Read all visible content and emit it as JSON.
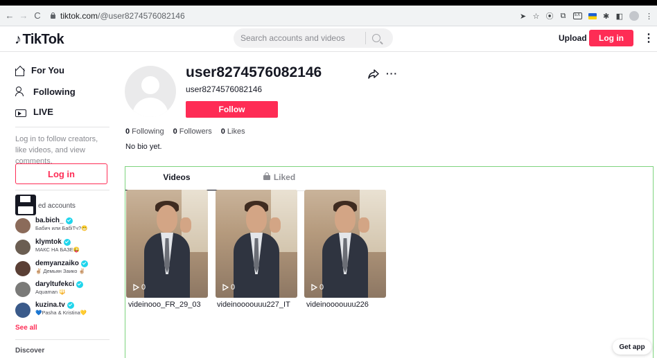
{
  "browser": {
    "url_domain": "tiktok.com",
    "url_path": "/@user8274576082146",
    "icons": [
      "back-icon",
      "forward-icon",
      "reload-icon",
      "lock-icon",
      "cast-icon",
      "star-icon",
      "extension-icons",
      "profile-icon",
      "menu-icon"
    ]
  },
  "header": {
    "logo": "TikTok",
    "search_placeholder": "Search accounts and videos",
    "upload_label": "Upload",
    "login_label": "Log in",
    "more_label": "⋮"
  },
  "sidebar": {
    "nav": [
      {
        "label": "For You",
        "icon": "home-icon"
      },
      {
        "label": "Following",
        "icon": "people-icon"
      },
      {
        "label": "LIVE",
        "icon": "live-icon"
      }
    ],
    "login_prompt": "Log in to follow creators, like videos, and view comments.",
    "login_button": "Log in",
    "suggested_label": "ed accounts",
    "accounts": [
      {
        "name": "ba.bich_",
        "subtitle": "Бабич или БабіТч?😬",
        "color": "#8b6b5a"
      },
      {
        "name": "klymtok",
        "subtitle": "МАКС НА БАЗЕ😜",
        "color": "#6b5e52"
      },
      {
        "name": "demyanzaiko",
        "subtitle": "✌🏼 Демьян Заико ✌🏼",
        "color": "#5a3f35"
      },
      {
        "name": "daryltufekci",
        "subtitle": "Aquaman 🔱",
        "color": "#7a7a78"
      },
      {
        "name": "kuzina.tv",
        "subtitle": "💙Pasha & Kristina💛",
        "color": "#3a5a8a"
      }
    ],
    "see_all": "See all",
    "discover": "Discover"
  },
  "profile": {
    "title": "user8274576082146",
    "subtitle": "user8274576082146",
    "follow_button": "Follow",
    "following_count": "0",
    "following_label": "Following",
    "followers_count": "0",
    "followers_label": "Followers",
    "likes_count": "0",
    "likes_label": "Likes",
    "bio": "No bio yet."
  },
  "tabs": {
    "videos": "Videos",
    "liked": "Liked"
  },
  "videos": [
    {
      "caption": "videinooo_FR_29_03",
      "views": "0"
    },
    {
      "caption": "videinoooouuu227_IT",
      "views": "0"
    },
    {
      "caption": "videinoooouuu226",
      "views": "0"
    }
  ],
  "get_app": "Get app",
  "colors": {
    "brand": "#fe2c55",
    "verified": "#20d5ec"
  }
}
